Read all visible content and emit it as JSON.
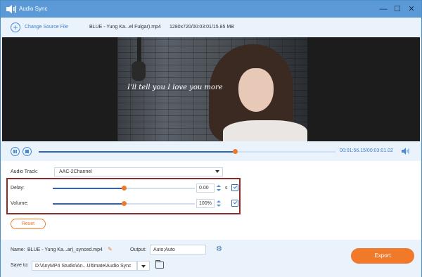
{
  "window": {
    "title": "Audio Sync",
    "controls": {
      "minimize": "—",
      "maximize": "☐",
      "close": "✕"
    }
  },
  "toolbar": {
    "change_source_label": "Change Source File",
    "file_name": "BLUE - Yung Ka...el Fulgar).mp4",
    "file_info": "1280x720/00:03:01/15.85 MB"
  },
  "video": {
    "lyric": "I'll tell you I love you more"
  },
  "player": {
    "progress": 0.66,
    "time": "00:01:56.15/00:03:01.02",
    "icons": [
      "pause-icon",
      "stop-icon",
      "volume-icon"
    ]
  },
  "settings": {
    "audio_track_label": "Audio Track:",
    "audio_track_value": "AAC-2Channel",
    "delay": {
      "label": "Delay:",
      "value": "0.00",
      "unit": "s",
      "level": 0.5
    },
    "volume": {
      "label": "Volume:",
      "value": "100%",
      "level": 0.5
    },
    "reset_label": "Reset"
  },
  "footer": {
    "name_label": "Name:",
    "name_value": "BLUE - Yung Ka...ar)_synced.mp4",
    "output_label": "Output:",
    "output_value": "Auto;Auto",
    "save_to_label": "Save to:",
    "save_to_value": "D:\\AnyMP4 Studio\\An...Ultimate\\Audio Sync",
    "export_label": "Export"
  },
  "colors": {
    "titlebar": "#5b9ad6",
    "accent": "#f07a2a",
    "progress": "#2e63b8",
    "highlight_box": "#8b2b2b"
  }
}
